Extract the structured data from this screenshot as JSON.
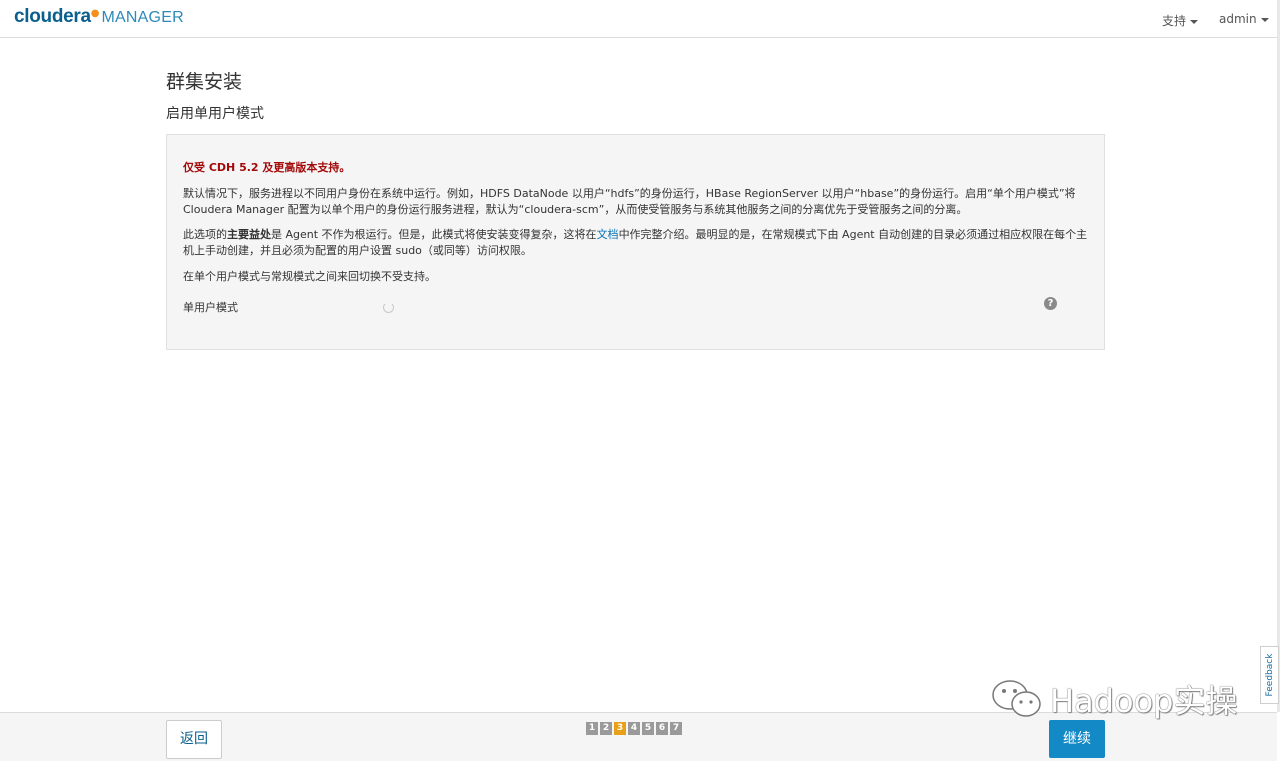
{
  "header": {
    "logo_primary": "cloudera",
    "logo_secondary": "MANAGER",
    "support_label": "支持",
    "user_label": "admin"
  },
  "page": {
    "title": "群集安装",
    "subtitle": "启用单用户模式"
  },
  "panel": {
    "warning": "仅受 CDH 5.2 及更高版本支持。",
    "para1": "默认情况下，服务进程以不同用户身份在系统中运行。例如，HDFS DataNode 以用户“hdfs”的身份运行，HBase RegionServer 以用户“hbase”的身份运行。启用“单个用户模式”将 Cloudera Manager 配置为以单个用户的身份运行服务进程，默认为“cloudera-scm”，从而使受管服务与系统其他服务之间的分离优先于受管服务之间的分离。",
    "para2_prefix": "此选项的",
    "para2_bold": "主要益处",
    "para2_mid": "是 Agent 不作为根运行。但是，此模式将使安装变得复杂，这将在",
    "para2_link": "文档",
    "para2_suffix": "中作完整介绍。最明显的是，在常规模式下由 Agent 自动创建的目录必须通过相应权限在每个主机上手动创建，并且必须为配置的用户设置 sudo（或同等）访问权限。",
    "para3": "在单个用户模式与常规模式之间来回切换不受支持。",
    "mode_label": "单用户模式",
    "help_glyph": "?"
  },
  "footer": {
    "back_label": "返回",
    "continue_label": "继续",
    "steps": [
      "1",
      "2",
      "3",
      "4",
      "5",
      "6",
      "7"
    ],
    "active_step": 3
  },
  "feedback_label": "Feedback",
  "watermark_text": "Hadoop实操",
  "colors": {
    "brand_dark": "#0a5f8e",
    "brand_orange": "#f3901d",
    "primary_button": "#1389c5",
    "warning_text": "#a30a0a",
    "step_active": "#e8a01a"
  }
}
